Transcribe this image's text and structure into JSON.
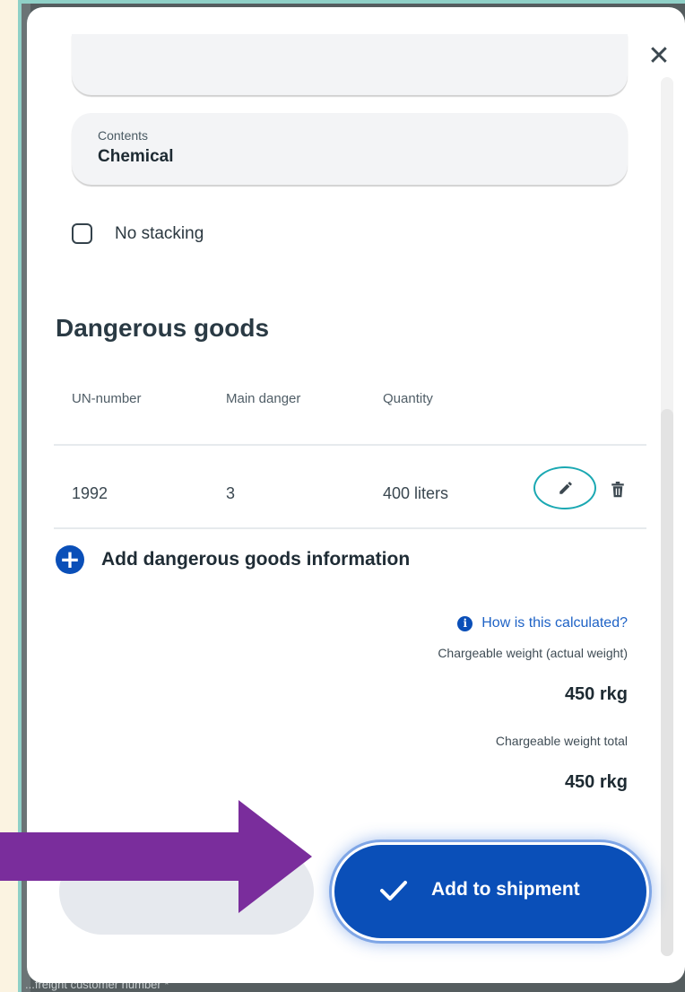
{
  "modal": {
    "close_symbol": "✕",
    "contents_field": {
      "label": "Contents",
      "value": "Chemical"
    },
    "no_stacking_label": "No stacking",
    "dangerous_goods": {
      "title": "Dangerous goods",
      "columns": [
        "UN-number",
        "Main danger",
        "Quantity"
      ],
      "rows": [
        {
          "un_number": "1992",
          "main_danger": "3",
          "quantity": "400 liters"
        }
      ],
      "add_label": "Add dangerous goods information"
    },
    "calculation": {
      "link_text": "How is this calculated?",
      "chargeable_label": "Chargeable weight (actual weight)",
      "chargeable_value": "450 rkg",
      "total_label": "Chargeable weight total",
      "total_value": "450 rkg"
    },
    "buttons": {
      "add_to_shipment": "Add to shipment"
    }
  },
  "background": {
    "footer_text": "...freight customer number *"
  },
  "colors": {
    "primary": "#0a4fb8",
    "edit_highlight": "#1aa8b2",
    "arrow": "#7a2d9c"
  },
  "icons": {
    "close": "close-icon",
    "edit": "pencil-icon",
    "delete": "trash-icon",
    "add": "plus-circle-icon",
    "info": "info-icon",
    "confirm": "checkmark-icon"
  }
}
